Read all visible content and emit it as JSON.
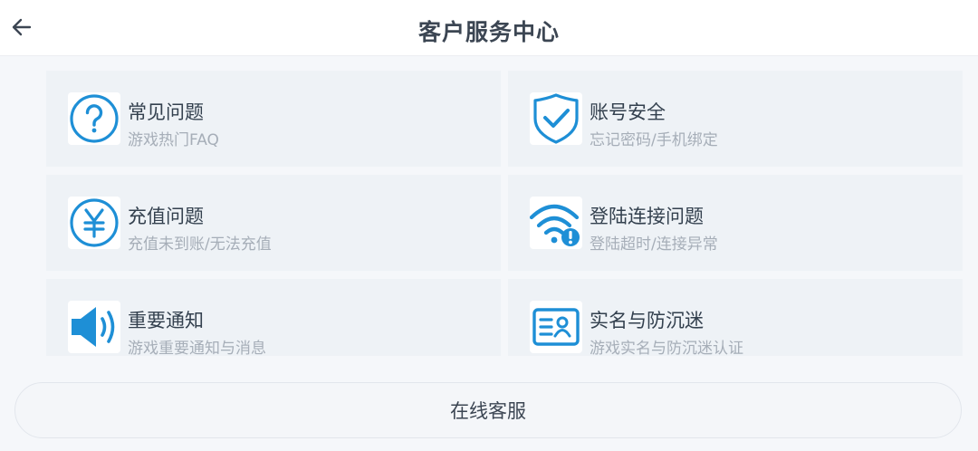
{
  "header": {
    "title": "客户服务中心",
    "back_icon": "arrow-left-icon"
  },
  "cards": [
    {
      "title": "常见问题",
      "subtitle": "游戏热门FAQ",
      "icon": "question-circle-icon"
    },
    {
      "title": "账号安全",
      "subtitle": "忘记密码/手机绑定",
      "icon": "shield-check-icon"
    },
    {
      "title": "充值问题",
      "subtitle": "充值未到账/无法充值",
      "icon": "yen-circle-icon"
    },
    {
      "title": "登陆连接问题",
      "subtitle": "登陆超时/连接异常",
      "icon": "wifi-alert-icon"
    },
    {
      "title": "重要通知",
      "subtitle": "游戏重要通知与消息",
      "icon": "speaker-icon"
    },
    {
      "title": "实名与防沉迷",
      "subtitle": "游戏实名与防沉迷认证",
      "icon": "id-card-icon"
    }
  ],
  "bottom": {
    "label": "在线客服"
  },
  "colors": {
    "accent": "#1e8fd6",
    "alert": "#1e8fd6"
  }
}
